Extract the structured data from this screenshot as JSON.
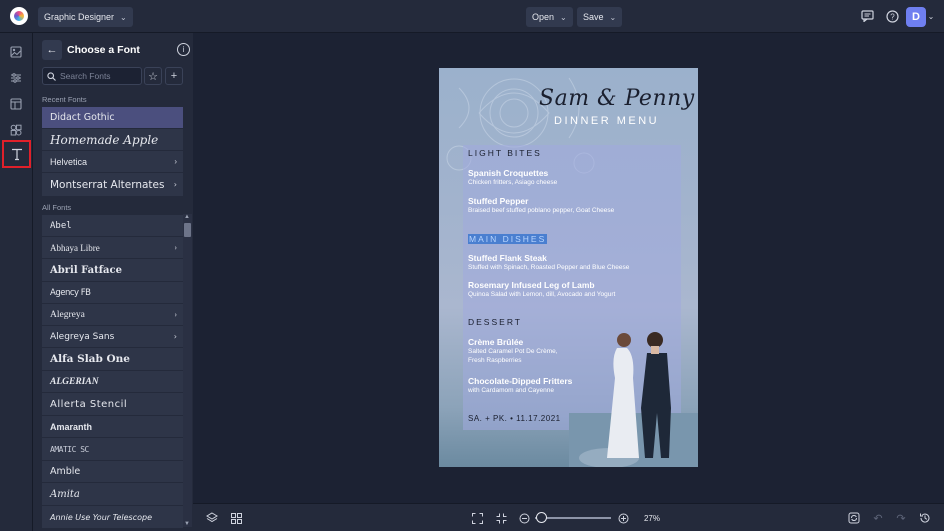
{
  "topbar": {
    "workspace_label": "Graphic Designer",
    "open_label": "Open",
    "save_label": "Save",
    "user_initial": "D"
  },
  "panel": {
    "title": "Choose a Font",
    "search_placeholder": "Search Fonts",
    "recent_label": "Recent Fonts",
    "all_label": "All Fonts",
    "recent_fonts": [
      {
        "name": "Didact Gothic",
        "has_arrow": false,
        "selected": true
      },
      {
        "name": "Homemade Apple",
        "has_arrow": false,
        "selected": false
      },
      {
        "name": "Helvetica",
        "has_arrow": true,
        "selected": false
      },
      {
        "name": "Montserrat Alternates",
        "has_arrow": true,
        "selected": false
      }
    ],
    "all_fonts": [
      {
        "name": "Abel",
        "has_arrow": false
      },
      {
        "name": "Abhaya Libre",
        "has_arrow": true
      },
      {
        "name": "Abril Fatface",
        "has_arrow": false
      },
      {
        "name": "Agency FB",
        "has_arrow": false
      },
      {
        "name": "Alegreya",
        "has_arrow": true
      },
      {
        "name": "Alegreya Sans",
        "has_arrow": true
      },
      {
        "name": "Alfa Slab One",
        "has_arrow": false
      },
      {
        "name": "ALGERIAN",
        "has_arrow": false
      },
      {
        "name": "Allerta Stencil",
        "has_arrow": false
      },
      {
        "name": "Amaranth",
        "has_arrow": false
      },
      {
        "name": "AMATIC SC",
        "has_arrow": false
      },
      {
        "name": "Amble",
        "has_arrow": false
      },
      {
        "name": "Amita",
        "has_arrow": false
      },
      {
        "name": "Annie Use Your Telescope",
        "has_arrow": false
      }
    ]
  },
  "design": {
    "title": "Sam & Penny",
    "subtitle": "DINNER MENU",
    "sections": [
      {
        "heading": "LIGHT BITES",
        "highlight": false
      },
      {
        "heading": "MAIN DISHES",
        "highlight": true
      },
      {
        "heading": "DESSERT",
        "highlight": false
      }
    ],
    "dishes": [
      {
        "name": "Spanish Croquettes",
        "desc": "Chicken fritters, Asiago cheese"
      },
      {
        "name": "Stuffed Pepper",
        "desc": "Braised beef stuffed poblano pepper, Goat Cheese"
      },
      {
        "name": "Stuffed Flank Steak",
        "desc": "Stuffed with Spinach, Roasted Pepper and Blue Cheese"
      },
      {
        "name": "Rosemary Infused Leg of Lamb",
        "desc": "Quinoa Salad with Lemon, dill, Avocado and Yogurt"
      },
      {
        "name": "Crème Brûlée",
        "desc": "Salted Caramel Pot De Crème,",
        "desc2": "Fresh Raspberries"
      },
      {
        "name": "Chocolate-Dipped Fritters",
        "desc": "with Cardamom and Cayenne"
      }
    ],
    "footer": "SA. + PK. • 11.17.2021"
  },
  "bottombar": {
    "zoom": "27%"
  },
  "colors": {
    "accent": "#6f7ff0",
    "selected_font": "#4b4f7e",
    "highlight": "#4a7fd0",
    "active_tool_border": "#e0202a"
  }
}
